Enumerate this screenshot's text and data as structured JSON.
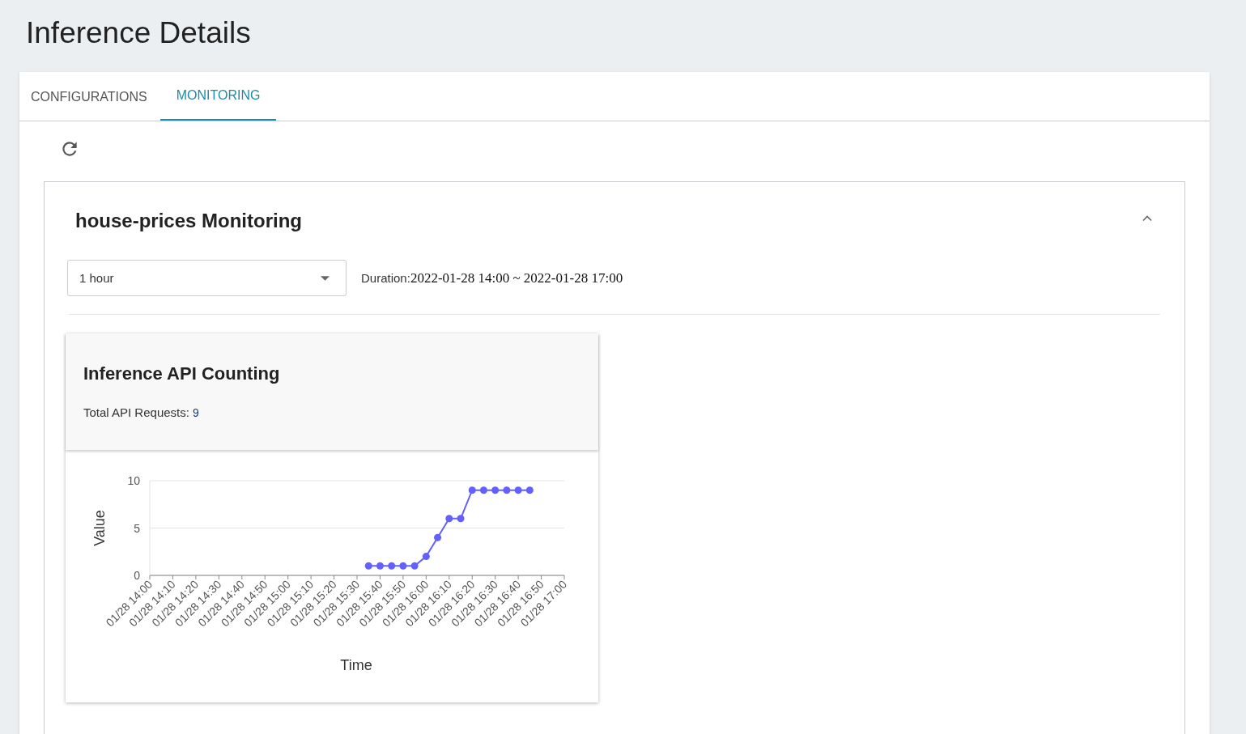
{
  "page_title": "Inference Details",
  "tabs": [
    {
      "label": "CONFIGURATIONS",
      "selected": false
    },
    {
      "label": "MONITORING",
      "selected": true
    }
  ],
  "panel": {
    "title": "house-prices Monitoring",
    "expanded": true,
    "range_select": {
      "value": "1 hour"
    },
    "duration_label": "Duration:",
    "duration_value": "2022-01-28 14:00 ~ 2022-01-28 17:00",
    "card": {
      "title": "Inference API Counting",
      "total_label": "Total API Requests:",
      "total_value": "9",
      "chart_data": {
        "type": "line",
        "xlabel": "Time",
        "ylabel": "Value",
        "categories": [
          "01/28 14:00",
          null,
          "01/28 14:10",
          null,
          "01/28 14:20",
          null,
          "01/28 14:30",
          null,
          "01/28 14:40",
          null,
          "01/28 14:50",
          null,
          "01/28 15:00",
          null,
          "01/28 15:10",
          null,
          "01/28 15:20",
          null,
          "01/28 15:30",
          null,
          "01/28 15:40",
          null,
          "01/28 15:50",
          null,
          "01/28 16:00",
          null,
          "01/28 16:10",
          null,
          "01/28 16:20",
          null,
          "01/28 16:30",
          null,
          "01/28 16:40",
          null,
          "01/28 16:50",
          null,
          "01/28 17:00"
        ],
        "series": [
          {
            "color": "#6360ff",
            "marker": "circle",
            "values": [
              null,
              null,
              null,
              null,
              null,
              null,
              null,
              null,
              null,
              null,
              null,
              null,
              null,
              null,
              null,
              null,
              null,
              null,
              null,
              1,
              1,
              1,
              1,
              1,
              2,
              4,
              6,
              6,
              9,
              9,
              9,
              9,
              9,
              9,
              null,
              null,
              null
            ]
          }
        ],
        "ylim": [
          0,
          10
        ],
        "yticks": [
          0,
          5,
          10
        ]
      }
    }
  }
}
